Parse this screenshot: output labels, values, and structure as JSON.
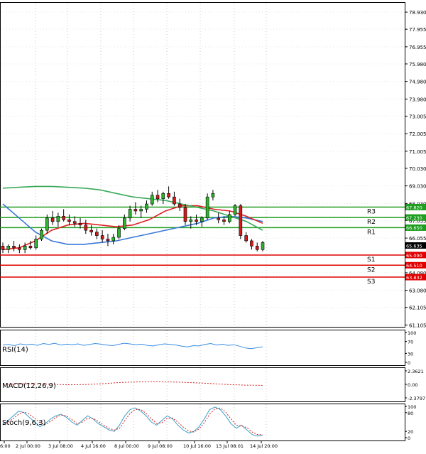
{
  "chart_data": {
    "type": "candlestick",
    "main": {
      "y_ticks": [
        "78.930",
        "77.955",
        "76.955",
        "75.980",
        "74.980",
        "73.980",
        "73.005",
        "72.005",
        "71.005",
        "70.030",
        "69.030",
        "68.030",
        "67.055",
        "66.055",
        "65.080",
        "64.080",
        "63.080",
        "62.105",
        "61.105"
      ],
      "y_range": [
        61.0,
        79.5
      ],
      "current_price": "65.635",
      "levels": [
        {
          "name": "R3",
          "value": 67.82,
          "label": "67.820",
          "color": "#1e9e1e"
        },
        {
          "name": "R2",
          "value": 67.23,
          "label": "67.230",
          "color": "#1e9e1e"
        },
        {
          "name": "R1",
          "value": 66.65,
          "label": "66.650",
          "color": "#1e9e1e"
        },
        {
          "name": "S1",
          "value": 65.09,
          "label": "65.090",
          "color": "#e00000"
        },
        {
          "name": "S2",
          "value": 64.51,
          "label": "64.510",
          "color": "#e00000"
        },
        {
          "name": "S3",
          "value": 63.832,
          "label": "63.832",
          "color": "#e00000"
        }
      ],
      "candles": [
        [
          65.6,
          65.8,
          65.2,
          65.4
        ],
        [
          65.4,
          65.7,
          65.2,
          65.6
        ],
        [
          65.6,
          65.9,
          65.3,
          65.5
        ],
        [
          65.5,
          65.7,
          65.2,
          65.4
        ],
        [
          65.4,
          65.8,
          65.2,
          65.6
        ],
        [
          65.6,
          65.9,
          65.4,
          65.5
        ],
        [
          65.5,
          66.2,
          65.4,
          66.0
        ],
        [
          66.0,
          66.6,
          65.9,
          66.5
        ],
        [
          66.5,
          67.4,
          66.3,
          67.2
        ],
        [
          67.2,
          67.6,
          66.8,
          67.0
        ],
        [
          67.0,
          67.5,
          66.7,
          67.3
        ],
        [
          67.3,
          67.7,
          67.0,
          67.1
        ],
        [
          67.1,
          67.4,
          66.8,
          67.0
        ],
        [
          67.0,
          67.3,
          66.7,
          66.9
        ],
        [
          66.9,
          67.2,
          66.6,
          66.8
        ],
        [
          66.8,
          67.1,
          66.3,
          66.5
        ],
        [
          66.5,
          66.8,
          66.2,
          66.4
        ],
        [
          66.4,
          66.6,
          66.0,
          66.2
        ],
        [
          66.2,
          66.5,
          65.8,
          66.0
        ],
        [
          66.0,
          66.3,
          65.6,
          65.9
        ],
        [
          65.9,
          66.3,
          65.7,
          66.1
        ],
        [
          66.1,
          66.8,
          66.0,
          66.6
        ],
        [
          66.6,
          67.4,
          66.5,
          67.2
        ],
        [
          67.2,
          67.9,
          67.0,
          67.7
        ],
        [
          67.7,
          68.1,
          67.4,
          67.6
        ],
        [
          67.6,
          67.9,
          67.2,
          67.7
        ],
        [
          67.7,
          68.2,
          67.5,
          68.0
        ],
        [
          68.0,
          68.7,
          67.9,
          68.5
        ],
        [
          68.5,
          68.8,
          68.1,
          68.3
        ],
        [
          68.3,
          68.7,
          68.0,
          68.6
        ],
        [
          68.6,
          69.0,
          68.3,
          68.4
        ],
        [
          68.4,
          68.7,
          67.9,
          68.0
        ],
        [
          68.0,
          68.3,
          67.6,
          67.8
        ],
        [
          67.8,
          68.0,
          66.8,
          67.0
        ],
        [
          67.0,
          67.3,
          66.6,
          67.1
        ],
        [
          67.1,
          67.4,
          66.8,
          67.0
        ],
        [
          67.0,
          67.3,
          66.7,
          67.2
        ],
        [
          67.2,
          68.6,
          67.1,
          68.4
        ],
        [
          68.4,
          68.8,
          68.2,
          68.6
        ],
        [
          67.2,
          67.5,
          66.9,
          67.1
        ],
        [
          67.1,
          67.3,
          66.8,
          67.0
        ],
        [
          67.0,
          67.6,
          66.9,
          67.4
        ],
        [
          67.4,
          68.0,
          67.3,
          67.9
        ],
        [
          67.9,
          68.0,
          66.0,
          66.2
        ],
        [
          66.2,
          66.4,
          65.8,
          65.9
        ],
        [
          65.9,
          66.0,
          65.4,
          65.6
        ],
        [
          65.6,
          65.8,
          65.3,
          65.4
        ],
        [
          65.4,
          65.9,
          65.3,
          65.8
        ]
      ],
      "series": [
        {
          "color": "#3a78d8",
          "values": [
            68.0,
            67.2,
            66.4,
            65.9,
            65.7,
            65.7,
            65.8,
            65.9,
            66.1,
            66.3,
            66.5,
            66.7,
            66.9,
            67.2,
            67.3,
            67.2,
            67.0
          ]
        },
        {
          "color": "#e02020",
          "values": [
            65.4,
            65.5,
            65.9,
            66.5,
            66.8,
            66.9,
            66.8,
            66.7,
            66.8,
            67.1,
            67.6,
            67.9,
            67.9,
            67.7,
            67.6,
            67.3,
            66.9
          ]
        },
        {
          "color": "#3aaa5a",
          "values": [
            68.9,
            68.95,
            69.0,
            69.0,
            68.95,
            68.9,
            68.8,
            68.6,
            68.4,
            68.3,
            68.2,
            68.0,
            67.8,
            67.6,
            67.3,
            67.0,
            66.5
          ]
        }
      ]
    },
    "rsi": {
      "label": "RSI(14)",
      "ticks": [
        "100",
        "70",
        "30",
        "0"
      ],
      "values": [
        58,
        60,
        56,
        62,
        59,
        61,
        57,
        63,
        60,
        64,
        58,
        61,
        59,
        62,
        57,
        60,
        63,
        61,
        58,
        56,
        60,
        64,
        62,
        59,
        61,
        57,
        55,
        59,
        62,
        60,
        58,
        54,
        52,
        56,
        55,
        60,
        63,
        58,
        61,
        57,
        59,
        54,
        48,
        46,
        49,
        52
      ]
    },
    "macd": {
      "label": "MACD(12,26,9)",
      "ticks": [
        "2.3621",
        "0.00",
        "-2.3797"
      ],
      "values": [
        -0.02,
        0.02,
        0.06,
        0.1,
        0.08,
        0.04,
        0.0,
        -0.04,
        -0.08,
        -0.06,
        -0.02,
        0.04,
        0.12,
        0.22,
        0.32,
        0.38,
        0.42,
        0.44,
        0.46,
        0.45,
        0.42,
        0.38,
        0.32,
        0.26,
        0.2,
        0.12,
        0.04,
        -0.04,
        -0.1,
        -0.14,
        -0.16,
        -0.18
      ]
    },
    "stoch": {
      "label": "Stoch(9,6,3)",
      "ticks": [
        "100",
        "80",
        "20",
        "0"
      ],
      "k": [
        40,
        55,
        70,
        85,
        80,
        65,
        50,
        35,
        45,
        60,
        70,
        75,
        65,
        50,
        40,
        55,
        70,
        60,
        45,
        35,
        25,
        20,
        40,
        70,
        90,
        95,
        85,
        70,
        50,
        40,
        55,
        70,
        60,
        40,
        25,
        15,
        20,
        35,
        60,
        90,
        98,
        90,
        70,
        45,
        30,
        40,
        25,
        10,
        5,
        8
      ],
      "d": [
        45,
        50,
        62,
        75,
        82,
        75,
        62,
        48,
        42,
        52,
        65,
        72,
        70,
        58,
        45,
        50,
        62,
        62,
        52,
        40,
        30,
        24,
        30,
        55,
        78,
        90,
        90,
        78,
        60,
        46,
        48,
        62,
        63,
        50,
        34,
        22,
        18,
        28,
        48,
        75,
        92,
        95,
        82,
        60,
        40,
        38,
        32,
        18,
        10,
        9
      ]
    },
    "x_labels": [
      "6:00",
      "2 Jul 00:00",
      "3 Jul 08:00",
      "4 Jul 16:00",
      "8 Jul 00:00",
      "9 Jul 08:00",
      "10 Jul 16:00",
      "13 Jul 08:01",
      "14 Jul 20:00"
    ]
  }
}
